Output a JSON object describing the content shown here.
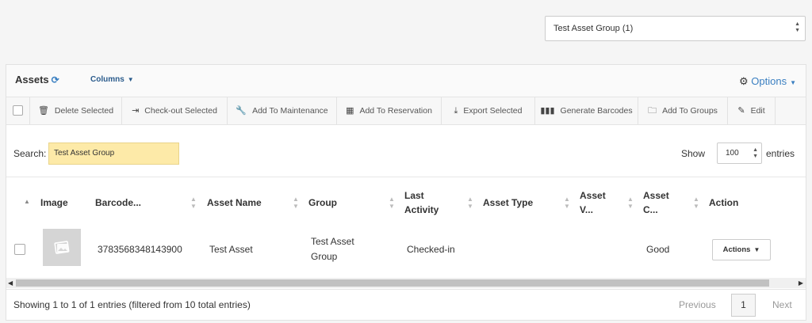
{
  "group_filter": {
    "value": "Test Asset Group (1)"
  },
  "panel": {
    "title": "Assets",
    "columns_label": "Columns",
    "options_label": "Options"
  },
  "toolbar": {
    "delete_selected": "Delete Selected",
    "checkout_selected": "Check-out Selected",
    "add_to_maintenance": "Add To Maintenance",
    "add_to_reservation": "Add To Reservation",
    "export_selected": "Export Selected",
    "generate_barcodes": "Generate Barcodes",
    "add_to_groups": "Add To Groups",
    "edit": "Edit"
  },
  "search": {
    "label": "Search:",
    "value": "Test Asset Group"
  },
  "length": {
    "show_label": "Show",
    "value": "100",
    "entries_label": "entries"
  },
  "table": {
    "headers": {
      "image": "Image",
      "barcode": "Barcode...",
      "asset_name": "Asset Name",
      "group": "Group",
      "last_activity_1": "Last",
      "last_activity_2": "Activity",
      "asset_type": "Asset Type",
      "asset_v_1": "Asset",
      "asset_v_2": "V...",
      "asset_c_1": "Asset",
      "asset_c_2": "C...",
      "action": "Action"
    },
    "rows": [
      {
        "barcode": "3783568348143900",
        "asset_name": "Test Asset",
        "group_1": "Test Asset",
        "group_2": "Group",
        "last_activity": "Checked-in",
        "asset_type": "",
        "asset_v": "",
        "asset_c": "Good",
        "action_label": "Actions"
      }
    ]
  },
  "footer": {
    "info": "Showing 1 to 1 of 1 entries (filtered from 10 total entries)",
    "previous": "Previous",
    "current_page": "1",
    "next": "Next"
  },
  "colors": {
    "accent": "#3a7fc1",
    "search_highlight": "#fdeaa8"
  }
}
